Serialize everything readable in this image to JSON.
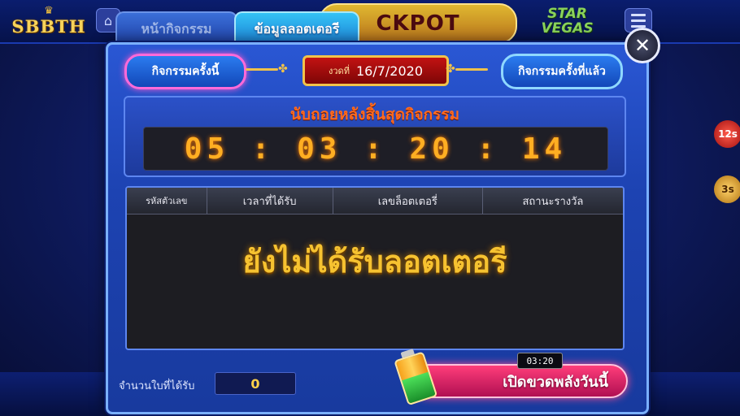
{
  "header": {
    "logo_text": "SBBTH",
    "jackpot_text": "CKPOT",
    "game_title": "STAR VEGAS"
  },
  "tabs": {
    "home_label": "หน้ากิจกรรม",
    "info_label": "ข้อมูลลอตเตอรี"
  },
  "modal": {
    "current_button": "กิจกรรมครั้งนี้",
    "last_button": "กิจกรรมครั้งที่แล้ว",
    "date_label": "งวดที่",
    "date_value": "16/7/2020",
    "countdown_title": "นับถอยหลังสิ้นสุดกิจกรรม",
    "countdown_value": "05 : 03 : 20 : 14",
    "table": {
      "headers": [
        "รหัสตัวเลข",
        "เวลาที่ได้รับ",
        "เลขล็อตเตอรี่",
        "สถานะรางวัล"
      ],
      "empty_message": "ยังไม่ได้รับลอตเตอรี"
    },
    "count_label": "จำนวนใบที่ได้รับ",
    "count_value": "0",
    "timer_badge": "03:20",
    "open_button": "เปิดขวดพลังวันนี้"
  },
  "side": {
    "timer1": "12s",
    "timer2": "3s"
  },
  "icons": {
    "close": "close-icon",
    "home": "home-icon",
    "menu": "menu-icon",
    "battery": "battery-icon"
  }
}
